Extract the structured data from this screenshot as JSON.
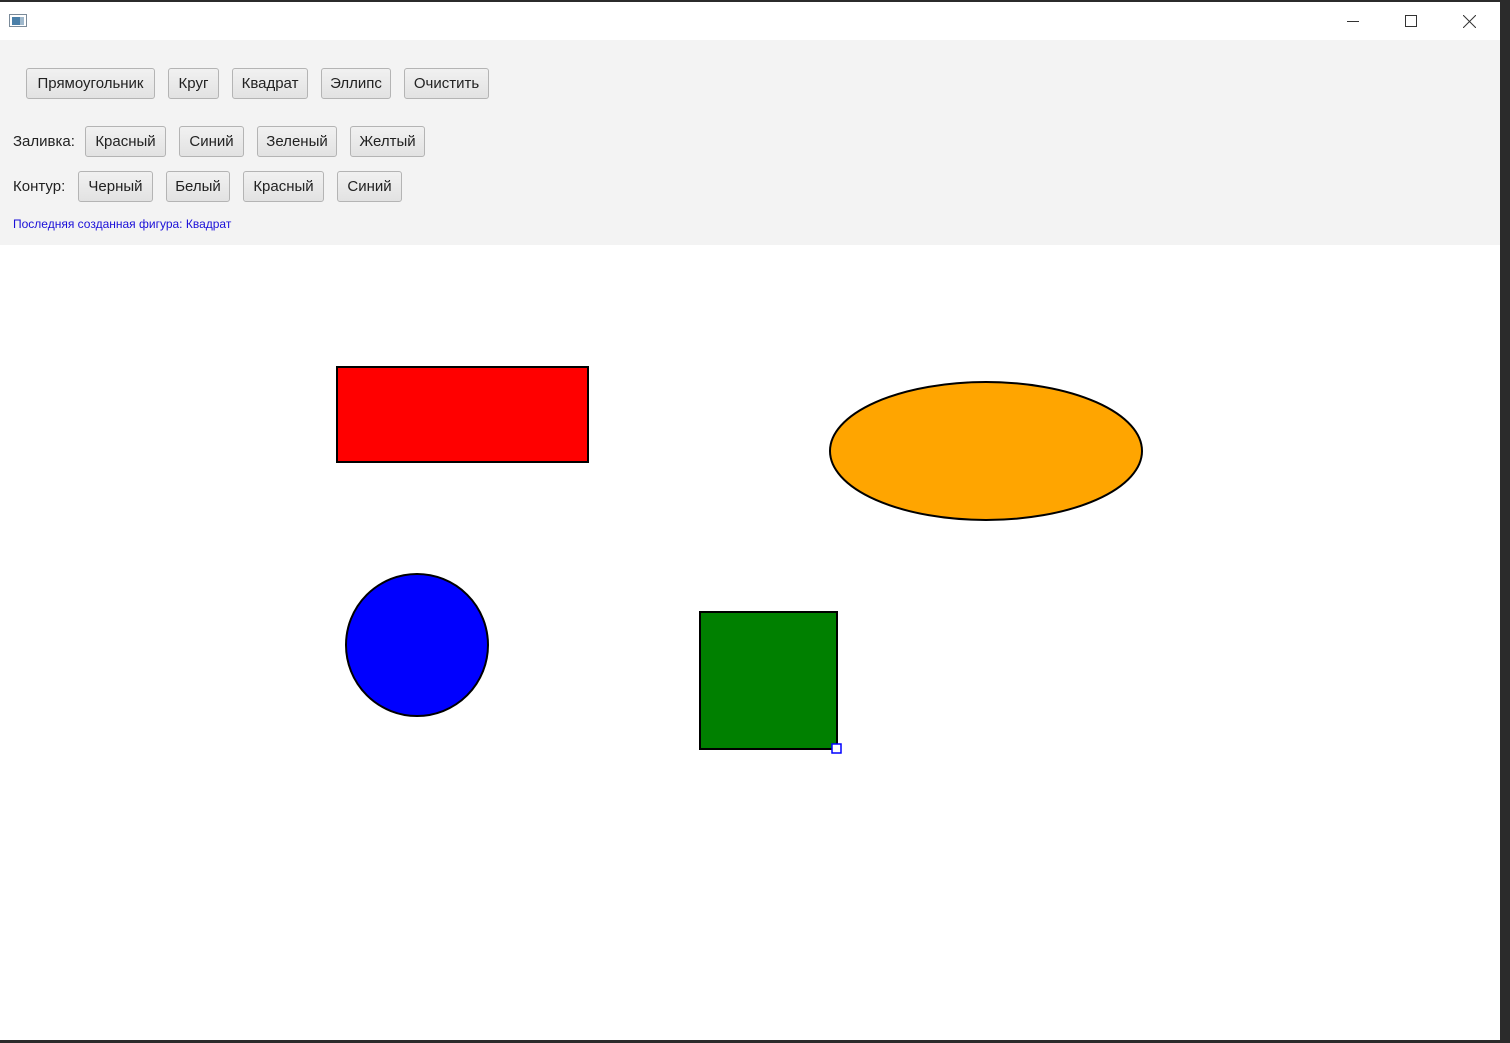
{
  "titlebar": {
    "title": "",
    "icons": [
      "app-icon",
      "minimize-icon",
      "maximize-icon",
      "close-icon"
    ]
  },
  "shape_buttons": [
    "Прямоугольник",
    "Круг",
    "Квадрат",
    "Эллипс",
    "Очистить"
  ],
  "fill": {
    "label": "Заливка:",
    "buttons": [
      "Красный",
      "Синий",
      "Зеленый",
      "Желтый"
    ]
  },
  "stroke": {
    "label": "Контур:",
    "buttons": [
      "Черный",
      "Белый",
      "Красный",
      "Синий"
    ]
  },
  "status": "Последняя созданная фигура: Квадрат",
  "canvas_shapes": [
    {
      "type": "rectangle",
      "fill": "#ff0000",
      "stroke": "#000000"
    },
    {
      "type": "ellipse",
      "fill": "#ffa500",
      "stroke": "#000000"
    },
    {
      "type": "circle",
      "fill": "#0000ff",
      "stroke": "#000000"
    },
    {
      "type": "square",
      "fill": "#008000",
      "stroke": "#000000",
      "selected": true
    }
  ],
  "colors": {
    "toolbar_bg": "#f3f3f3",
    "status_text": "#1a0fd8",
    "selection_handle": "#0000ff"
  }
}
